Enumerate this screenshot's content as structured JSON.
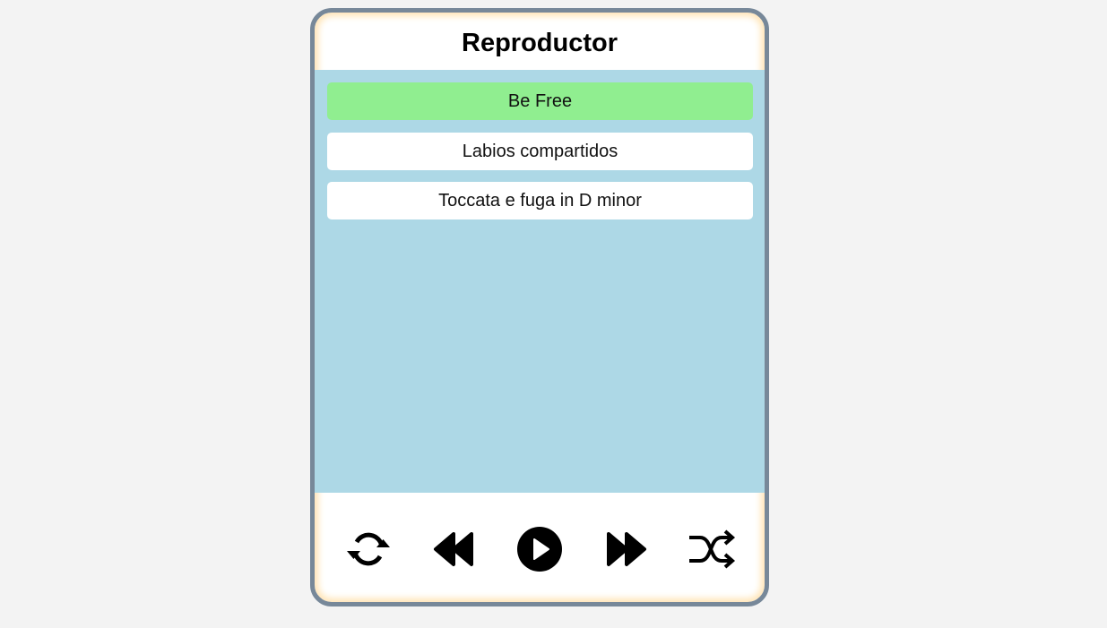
{
  "header": {
    "title": "Reproductor"
  },
  "playlist": {
    "tracks": [
      {
        "label": "Be Free",
        "active": true
      },
      {
        "label": "Labios compartidos",
        "active": false
      },
      {
        "label": "Toccata e fuga in D minor",
        "active": false
      }
    ]
  },
  "controls": {
    "buttons": [
      {
        "icon": "repeat-icon"
      },
      {
        "icon": "previous-icon"
      },
      {
        "icon": "play-icon"
      },
      {
        "icon": "next-icon"
      },
      {
        "icon": "shuffle-icon"
      }
    ]
  },
  "colors": {
    "page_background": "#f3f3f3",
    "frame_border": "#778899",
    "frame_glow": "#ffe4b5",
    "playlist_background": "#add8e6",
    "active_track": "#90ee90",
    "track_background": "#ffffff"
  }
}
